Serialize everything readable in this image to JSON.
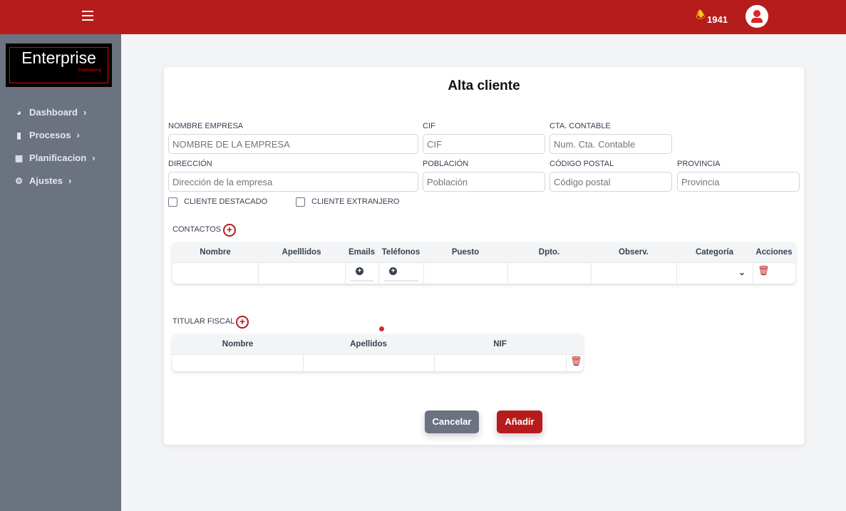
{
  "topbar": {
    "menu_icon": "hamburger-icon",
    "bell_icon": "bell-icon",
    "notification_count": "1941",
    "user_icon": "user-icon",
    "accent": "#b71c1c"
  },
  "logo": {
    "title": "Enterprise",
    "subtitle": "Engineering"
  },
  "sidebar": {
    "items": [
      {
        "label": "Dashboard",
        "icon": "gauge-icon"
      },
      {
        "label": "Procesos",
        "icon": "clipboard-icon"
      },
      {
        "label": "Planificacion",
        "icon": "calendar-icon"
      },
      {
        "label": "Ajustes",
        "icon": "gears-icon"
      }
    ]
  },
  "form": {
    "title": "Alta cliente",
    "fields": [
      {
        "label": "NOMBRE EMPRESA",
        "placeholder": "NOMBRE DE LA EMPRESA"
      },
      {
        "label": "CIF",
        "placeholder": "CIF"
      },
      {
        "label": "CTA. CONTABLE",
        "placeholder": "Num. Cta. Contable"
      },
      {
        "label": "DIRECCIÓN",
        "placeholder": "Dirección de la empresa"
      },
      {
        "label": "POBLACIÓN",
        "placeholder": "Población"
      },
      {
        "label": "CÓDIGO POSTAL",
        "placeholder": "Código postal"
      },
      {
        "label": "PROVINCIA",
        "placeholder": "Provincia"
      }
    ],
    "checkboxes": [
      "CLIENTE DESTACADO",
      "CLIENTE EXTRANJERO"
    ],
    "contacts": {
      "label": "CONTACTOS",
      "headers": [
        "Nombre",
        "Apelllidos",
        "Emails",
        "Teléfonos",
        "Puesto",
        "Dpto.",
        "Observ.",
        "Categoría",
        "Acciones"
      ]
    },
    "titular": {
      "label": "TITULAR FISCAL",
      "headers": [
        "Nombre",
        "Apellidos",
        "NIF"
      ]
    },
    "cancel_label": "Cancelar",
    "add_label": "Añadir"
  }
}
